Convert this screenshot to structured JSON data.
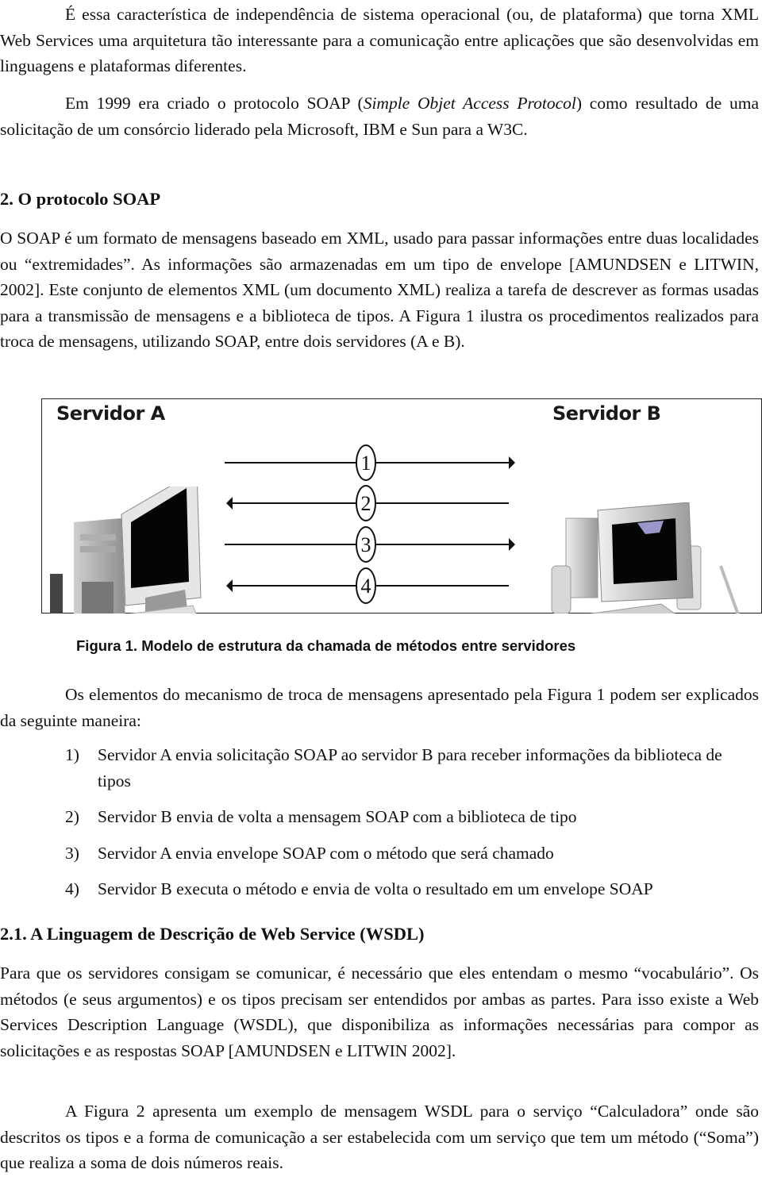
{
  "paragraphs": {
    "p1": "É essa característica de independência de sistema operacional (ou, de plataforma) que torna XML Web Services uma arquitetura tão interessante para a comunicação entre aplicações que são desenvolvidas em linguagens e plataformas diferentes.",
    "p2_before": "Em 1999 era criado o protocolo SOAP (",
    "p2_italic": "Simple Objet Access Protocol",
    "p2_after": ") como resultado de uma solicitação de um consórcio liderado pela Microsoft, IBM e Sun para a W3C.",
    "p3": "O SOAP é um formato de mensagens baseado em XML, usado para passar informações entre duas localidades ou “extremidades”. As informações são armazenadas em um tipo de envelope [AMUNDSEN e LITWIN, 2002]. Este conjunto de elementos XML (um documento XML) realiza a tarefa de descrever as formas usadas para a transmissão de mensagens e a biblioteca de tipos. A Figura 1 ilustra os procedimentos realizados para troca de mensagens, utilizando SOAP, entre dois servidores (A e B).",
    "p4": "Os elementos do mecanismo de troca de mensagens apresentado pela Figura 1 podem ser explicados da seguinte maneira:",
    "p5": "Para que os servidores consigam se comunicar, é necessário que eles entendam o mesmo “vocabulário”. Os métodos (e seus argumentos) e os tipos precisam ser entendidos por ambas as partes. Para isso existe a Web Services Description Language (WSDL), que disponibiliza as informações necessárias para compor as solicitações e as respostas SOAP [AMUNDSEN e LITWIN 2002].",
    "p6": "A Figura 2 apresenta um exemplo de mensagem WSDL para o serviço “Calculadora” onde são descritos os tipos e a forma de comunicação a ser estabelecida com um serviço que tem um método (“Soma”) que realiza a soma de dois números reais."
  },
  "headings": {
    "h2": "2. O protocolo SOAP",
    "h21": "2.1. A Linguagem de Descrição de Web Service (WSDL)"
  },
  "figure": {
    "server_a_label": "Servidor A",
    "server_b_label": "Servidor B",
    "arrows": [
      {
        "number": "1",
        "direction": "right"
      },
      {
        "number": "2",
        "direction": "left"
      },
      {
        "number": "3",
        "direction": "right"
      },
      {
        "number": "4",
        "direction": "left"
      }
    ],
    "caption": "Figura 1. Modelo de estrutura da chamada de métodos entre servidores"
  },
  "steps": [
    {
      "num": "1)",
      "text": "Servidor A envia solicitação SOAP ao servidor B para receber informações da biblioteca de tipos"
    },
    {
      "num": "2)",
      "text": "Servidor B envia de volta a mensagem SOAP com a biblioteca de tipo"
    },
    {
      "num": "3)",
      "text": "Servidor A envia envelope SOAP com o método que será chamado"
    },
    {
      "num": "4)",
      "text": "Servidor B executa o método e envia de volta o resultado em um envelope SOAP"
    }
  ]
}
